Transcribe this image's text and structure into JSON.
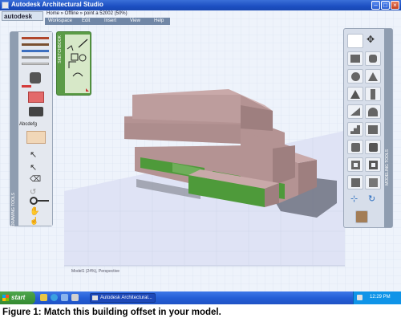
{
  "window": {
    "title": "Autodesk Architectural Studio"
  },
  "app": {
    "logo": "autodesk",
    "breadcrumb": "Home » Offline » point a 52002 (50%)",
    "menu": [
      "Workspace",
      "Edit",
      "Insert",
      "View",
      "Help"
    ]
  },
  "left_panel": {
    "strip_label": "DRAWING TOOLS",
    "text_tool_label": "Abcdefg"
  },
  "sketch_panel": {
    "label": "SKETCHBOOK"
  },
  "right_panel": {
    "strip_label": "MODELING TOOLS",
    "buttons": [
      "box-icon",
      "cylinder-icon",
      "sphere-icon",
      "cone-icon",
      "wedge-icon",
      "arch-icon",
      "column-icon",
      "pyramid-icon",
      "stairs-icon",
      "window-icon",
      "door-icon",
      "wall-icon",
      "cube-icon",
      "block-icon",
      "wall-opening-icon",
      "solid-icon",
      "move-icon",
      "rotate-icon",
      "extrude-icon"
    ]
  },
  "viewport": {
    "status": "Model1 (24%), Perspective",
    "colors": {
      "roof": "#c9a9a9",
      "front": "#b49393",
      "side": "#9e7f7f",
      "glazing": "#4e9a3a",
      "floor": "#dfe3f5"
    }
  },
  "taskbar": {
    "start": "start",
    "task": "Autodesk Architectural...",
    "clock": "12:29 PM"
  },
  "caption": "Figure 1: Match this building offset in your model."
}
